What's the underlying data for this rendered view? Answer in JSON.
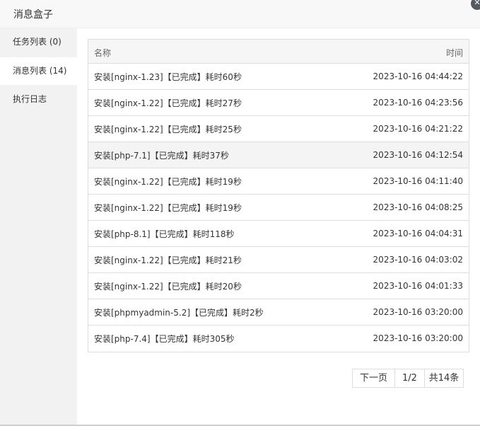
{
  "dialog": {
    "title": "消息盒子",
    "close_icon": "close-icon"
  },
  "sidebar": {
    "items": [
      {
        "label": "任务列表 (0)"
      },
      {
        "label": "消息列表 (14)"
      },
      {
        "label": "执行日志"
      }
    ],
    "active_index": 1
  },
  "table": {
    "columns": [
      "名称",
      "时间"
    ],
    "rows": [
      {
        "name": "安装[nginx-1.23]【已完成】耗时60秒",
        "time": "2023-10-16 04:44:22"
      },
      {
        "name": "安装[nginx-1.22]【已完成】耗时27秒",
        "time": "2023-10-16 04:23:56"
      },
      {
        "name": "安装[nginx-1.22]【已完成】耗时25秒",
        "time": "2023-10-16 04:21:22"
      },
      {
        "name": "安装[php-7.1]【已完成】耗时37秒",
        "time": "2023-10-16 04:12:54"
      },
      {
        "name": "安装[nginx-1.22]【已完成】耗时19秒",
        "time": "2023-10-16 04:11:40"
      },
      {
        "name": "安装[nginx-1.22]【已完成】耗时19秒",
        "time": "2023-10-16 04:08:25"
      },
      {
        "name": "安装[php-8.1]【已完成】耗时118秒",
        "time": "2023-10-16 04:04:31"
      },
      {
        "name": "安装[nginx-1.22]【已完成】耗时21秒",
        "time": "2023-10-16 04:03:02"
      },
      {
        "name": "安装[nginx-1.22]【已完成】耗时20秒",
        "time": "2023-10-16 04:01:33"
      },
      {
        "name": "安装[phpmyadmin-5.2]【已完成】耗时2秒",
        "time": "2023-10-16 03:20:00"
      },
      {
        "name": "安装[php-7.4]【已完成】耗时305秒",
        "time": "2023-10-16 03:20:00"
      }
    ]
  },
  "pagination": {
    "next_label": "下一页",
    "page_label": "1/2",
    "total_label": "共14条"
  }
}
